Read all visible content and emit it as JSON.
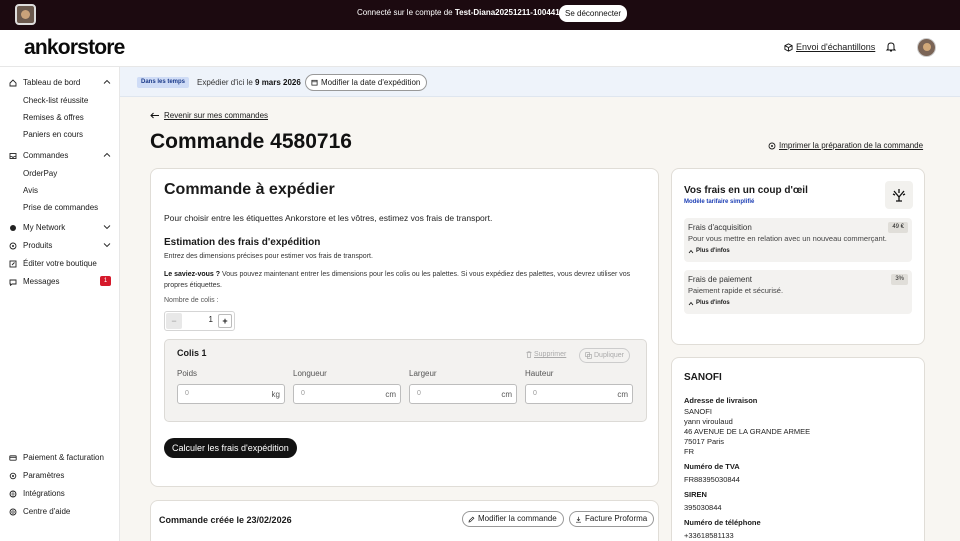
{
  "topbar": {
    "connected_prefix": "Connecté sur le compte de",
    "account": "Test-Diana20251211-100441",
    "logout": "Se déconnecter"
  },
  "header": {
    "logo": "ankorstore",
    "samples": "Envoi d'échantillons"
  },
  "sidebar": {
    "dashboard": "Tableau de bord",
    "dashboard_sub": [
      "Check-list réussite",
      "Remises & offres",
      "Paniers en cours"
    ],
    "orders": "Commandes",
    "orders_sub": [
      "OrderPay",
      "Avis",
      "Prise de commandes"
    ],
    "network": "My Network",
    "products": "Produits",
    "edit_shop": "Éditer votre boutique",
    "messages": "Messages",
    "messages_count": "1",
    "billing": "Paiement & facturation",
    "settings": "Paramètres",
    "integrations": "Intégrations",
    "help": "Centre d'aide"
  },
  "banner": {
    "tag": "Dans les temps",
    "ship_prefix": "Expédier d'ici le",
    "ship_date": "9 mars 2026",
    "edit_date": "Modifier la date d'expédition"
  },
  "page": {
    "back": "Revenir sur mes commandes",
    "title": "Commande 4580716",
    "print": "Imprimer la préparation de la commande"
  },
  "shipping": {
    "title": "Commande à expédier",
    "intro": "Pour choisir entre les étiquettes Ankorstore et les vôtres, estimez vos frais de transport.",
    "subtitle": "Estimation des frais d'expédition",
    "p1": "Entrez des dimensions précises pour estimer vos frais de transport.",
    "tip_label": "Le saviez-vous ?",
    "tip": "Vous pouvez maintenant entrer les dimensions pour les colis ou les palettes. Si vous expédiez des palettes, vous devrez utiliser vos propres étiquettes.",
    "count_label": "Nombre de colis :",
    "count": "1",
    "parcel_title": "Colis 1",
    "delete": "Supprimer",
    "duplicate": "Dupliquer",
    "fields": [
      {
        "label": "Poids",
        "placeholder": "0",
        "unit": "kg"
      },
      {
        "label": "Longueur",
        "placeholder": "0",
        "unit": "cm"
      },
      {
        "label": "Largeur",
        "placeholder": "0",
        "unit": "cm"
      },
      {
        "label": "Hauteur",
        "placeholder": "0",
        "unit": "cm"
      }
    ],
    "calculate": "Calculer les frais d'expédition"
  },
  "order": {
    "created": "Commande créée le 23/02/2026",
    "edit": "Modifier la commande",
    "proforma": "Facture Proforma"
  },
  "fees": {
    "title": "Vos frais en un coup d'œil",
    "model": "Modèle tarifaire simplifié",
    "items": [
      {
        "title": "Frais d'acquisition",
        "desc": "Pour vous mettre en relation avec un nouveau commerçant.",
        "value": "49 €",
        "more": "Plus d'infos"
      },
      {
        "title": "Frais de paiement",
        "desc": "Paiement rapide et sécurisé.",
        "value": "3%",
        "more": "Plus d'infos"
      }
    ]
  },
  "client": {
    "name": "SANOFI",
    "address_label": "Adresse de livraison",
    "address": [
      "SANOFI",
      "yann viroulaud",
      "46 AVENUE DE LA GRANDE ARMEE",
      "75017 Paris",
      "FR"
    ],
    "vat_label": "Numéro de TVA",
    "vat": "FR88395030844",
    "siren_label": "SIREN",
    "siren": "395030844",
    "phone_label": "Numéro de téléphone",
    "phone": "+33618581133"
  }
}
